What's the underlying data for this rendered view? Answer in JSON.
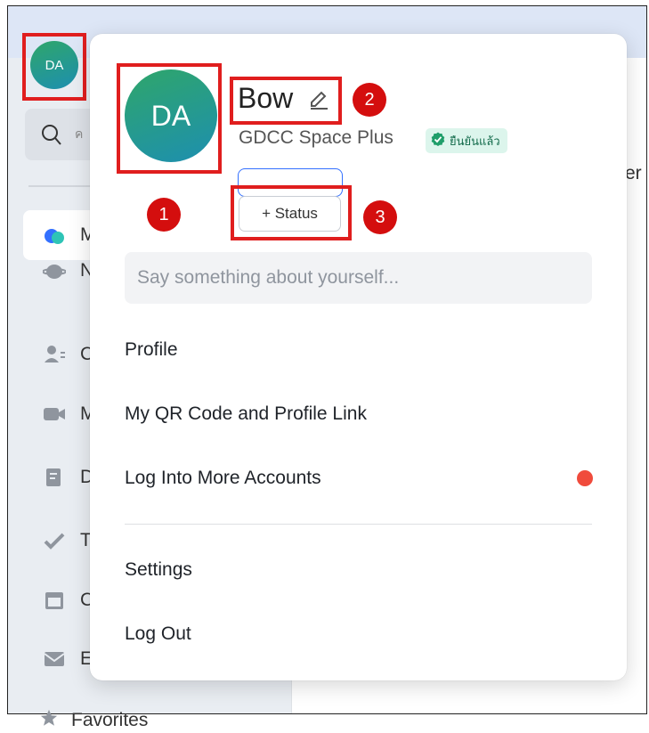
{
  "mini_avatar_initials": "DA",
  "big_avatar_initials": "DA",
  "search_partial": "ค",
  "sidebar": {
    "items": [
      {
        "icon": "messenger-icon",
        "label": "M"
      },
      {
        "icon": "moments-icon",
        "label": "N"
      },
      {
        "icon": "contacts-icon",
        "label": "C"
      },
      {
        "icon": "video-meeting-icon",
        "label": "M"
      },
      {
        "icon": "docs-icon",
        "label": "D"
      },
      {
        "icon": "tasks-icon",
        "label": "T"
      },
      {
        "icon": "calendar-icon",
        "label": "C"
      },
      {
        "icon": "email-icon",
        "label": "E"
      }
    ],
    "favorites_label": "Favorites"
  },
  "main_partial_text": "er",
  "profile": {
    "name": "Bow",
    "organization": "GDCC Space Plus",
    "verified_label": "ยืนยันแล้ว",
    "status_button": "+ Status",
    "about_placeholder": "Say something about yourself..."
  },
  "menu": {
    "profile": "Profile",
    "qr_code": "My QR Code and Profile Link",
    "more_accounts": "Log Into More Accounts",
    "settings": "Settings",
    "log_out": "Log Out"
  },
  "callouts": [
    "1",
    "2",
    "3"
  ],
  "colors": {
    "annotation_red": "#e01e1e",
    "avatar_start": "#2fa66a",
    "avatar_end": "#1d8fb0",
    "notification_dot": "#f04b3c",
    "verified_bg": "#dcf5ec"
  }
}
